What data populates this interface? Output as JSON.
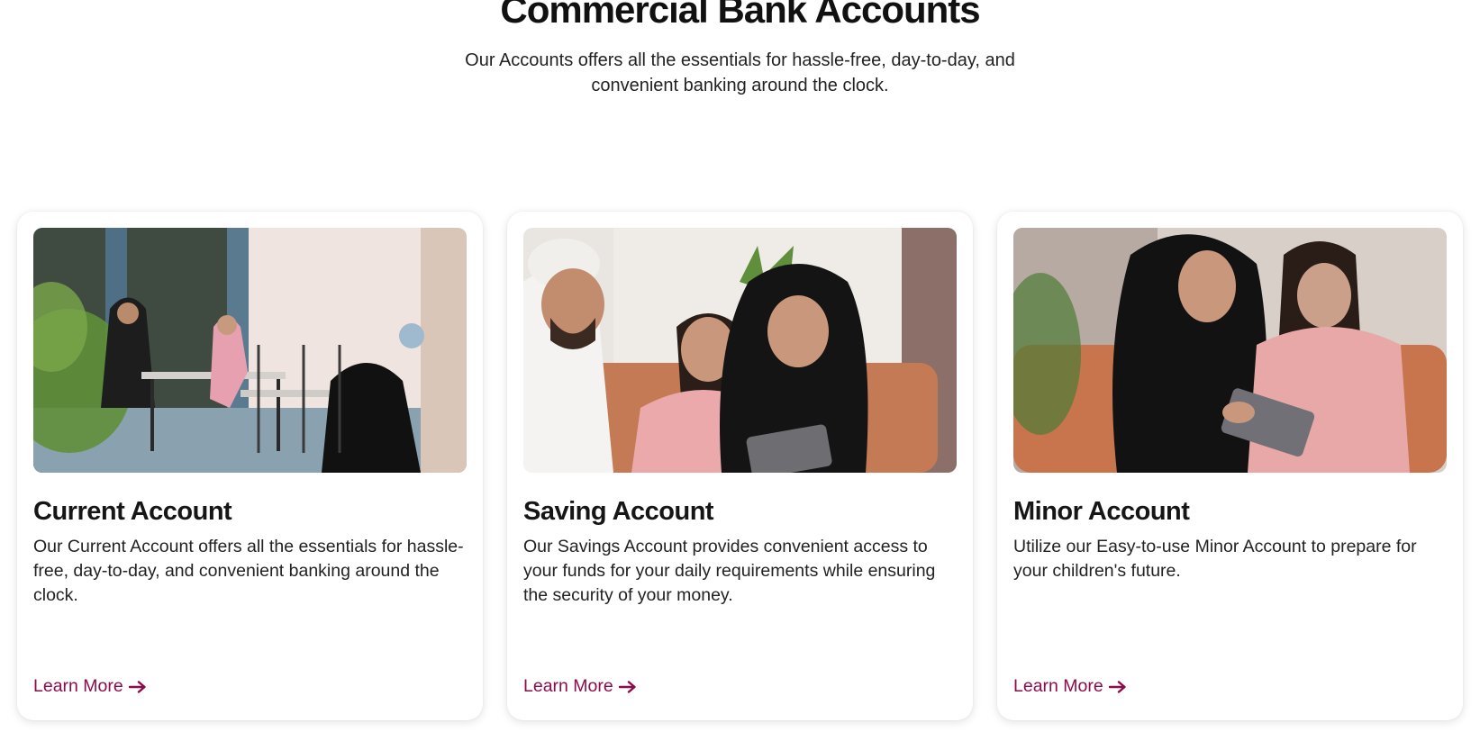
{
  "section": {
    "title": "Commercial Bank Accounts",
    "subtitle": "Our Accounts offers all the essentials for hassle-free, day-to-day, and convenient banking around the clock."
  },
  "colors": {
    "accent": "#8a0c4d",
    "heading": "#111111",
    "body_text": "#222222"
  },
  "cards": [
    {
      "title": "Current Account",
      "description": "Our Current Account offers all the essentials for hassle-free, day-to-day, and convenient banking around the clock.",
      "link_label": "Learn More",
      "link_icon": "arrow-right-icon"
    },
    {
      "title": "Saving Account",
      "description": "Our Savings Account provides convenient access to your funds for your daily requirements while ensuring the security of your money.",
      "link_label": "Learn More",
      "link_icon": "arrow-right-icon"
    },
    {
      "title": "Minor Account",
      "description": "Utilize our Easy-to-use Minor Account to prepare for your children's future.",
      "link_label": "Learn More",
      "link_icon": "arrow-right-icon"
    }
  ]
}
